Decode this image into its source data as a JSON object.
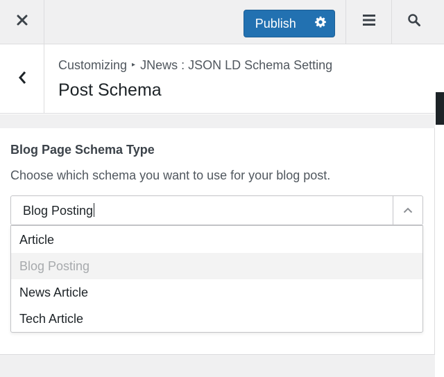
{
  "header": {
    "publish_label": "Publish",
    "icons": {
      "close": "close-icon",
      "settings": "gear-icon",
      "menu": "menu-icon",
      "search": "search-icon"
    }
  },
  "section": {
    "breadcrumb": [
      "Customizing",
      "JNews : JSON LD Schema Setting"
    ],
    "title": "Post Schema"
  },
  "control": {
    "title": "Blog Page Schema Type",
    "description": "Choose which schema you want to use for your blog post.",
    "select_value": "Blog Posting",
    "options": [
      "Article",
      "Blog Posting",
      "News Article",
      "Tech Article"
    ],
    "selected_index": 1
  },
  "colors": {
    "accent": "#2271b1",
    "header_bg": "#f0f0f1",
    "border": "#dcdcde",
    "selected_option_text": "#a7aaad"
  }
}
